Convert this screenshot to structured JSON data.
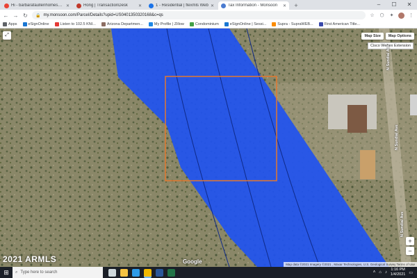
{
  "browser": {
    "tabs": [
      {
        "title": "Hi - barbarafaullenhomes@g...",
        "favicon_color": "#ea4335",
        "icon": "gmail-icon"
      },
      {
        "title": "Hong | TransactionDesk",
        "favicon_color": "#c0392b",
        "icon": "transactiondesk-icon"
      },
      {
        "title": "1 - Residential | flexmls Web",
        "favicon_color": "#1a73e8",
        "icon": "flexmls-icon"
      },
      {
        "title": "Tax Information - Monsoon",
        "favicon_color": "#4a7bd0",
        "icon": "monsoon-icon"
      }
    ],
    "active_tab": 3,
    "new_tab_label": "+",
    "url": "my.monsoon.com/Parcel/Details?upid=US0401350320168&c=qs",
    "bookmarks": [
      {
        "label": "Apps",
        "color": "#5f6368"
      },
      {
        "label": "eSignOnline",
        "color": "#1976d2"
      },
      {
        "label": "Listen to 102.5 KNI...",
        "color": "#e53935"
      },
      {
        "label": "Arizona Departmen...",
        "color": "#8d6e63"
      },
      {
        "label": "My Profile | Zillow",
        "color": "#1e88e5"
      },
      {
        "label": "Condominium",
        "color": "#43a047"
      },
      {
        "label": "eSignOnline | Sessi...",
        "color": "#1976d2"
      },
      {
        "label": "Supra - SupraWEB...",
        "color": "#fb8c00"
      },
      {
        "label": "First American Title...",
        "color": "#3949ab"
      }
    ]
  },
  "map": {
    "map_size_label": "Map Size",
    "map_options_label": "Map Options",
    "extension_tooltip": "Cisco Webex Extension",
    "expand_label": "⤢",
    "zoom_in_label": "+",
    "zoom_out_label": "−",
    "road_label_1": "N Sundial Ave",
    "road_label_2": "N Sundial Ave",
    "road_label_3": "N Sundial Ave",
    "attribution": "Map data ©2021 Imagery ©2021 , Maxar Technologies, U.S. Geological Survey   Terms of Use",
    "google_logo": "Google",
    "watermark": "2021 ARMLS",
    "colors": {
      "flood_zone": "#1f52f0",
      "parcel_outline": "#e2792f",
      "terrain": "#8a8768"
    }
  },
  "taskbar": {
    "search_placeholder": "Type here to search",
    "time": "1:16 PM",
    "date": "1/4/2021",
    "apps": [
      {
        "name": "task-view-icon",
        "color": "#cfd8dc"
      },
      {
        "name": "folder-icon",
        "color": "#f6c343"
      },
      {
        "name": "edge-icon",
        "color": "#2e9be8"
      },
      {
        "name": "chrome-icon",
        "color": "#f2b900"
      },
      {
        "name": "word-icon",
        "color": "#2b579a"
      },
      {
        "name": "excel-icon",
        "color": "#217346"
      }
    ]
  }
}
